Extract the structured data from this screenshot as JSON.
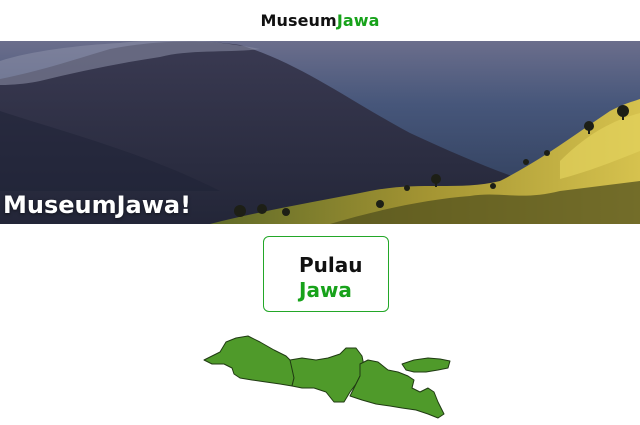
{
  "header": {
    "brand_part1": "Museum",
    "brand_part2": "Jawa",
    "accent_color": "#17a21a"
  },
  "hero": {
    "title": "MuseumJawa!",
    "image": "volcano-mountain-landscape-photo"
  },
  "island_card": {
    "line1": "Pulau",
    "line2": "Jawa",
    "border_color": "#23a728"
  },
  "map": {
    "image": "java-island-province-map",
    "fill_color": "#4f9a2a",
    "regions": [
      "west-java",
      "central-java",
      "east-java",
      "madura"
    ]
  }
}
